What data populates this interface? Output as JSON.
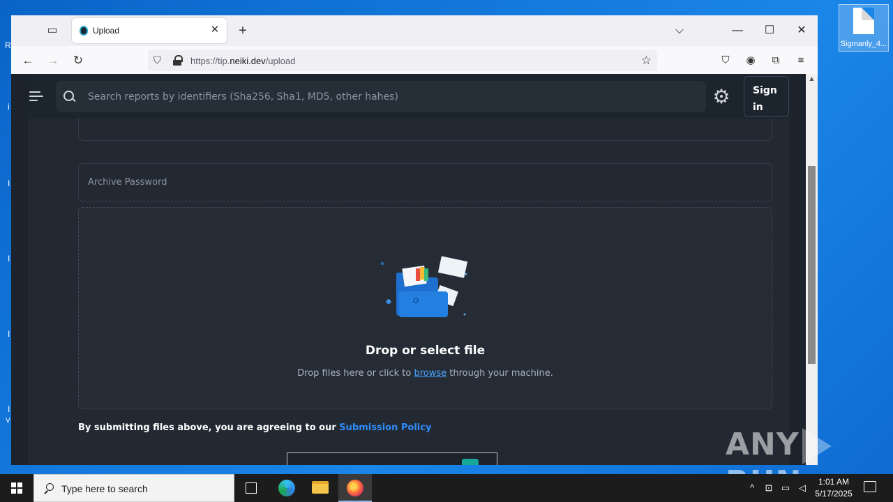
{
  "desktop": {
    "file_label": "Sigmanly_4...",
    "left_letters": [
      "R",
      "i",
      "I",
      "I",
      "I",
      "I",
      "V"
    ]
  },
  "browser": {
    "tab": {
      "title": "Upload"
    },
    "url": {
      "prefix": "https://tip.",
      "domain": "neiki.dev",
      "path": "/upload"
    }
  },
  "app": {
    "search": {
      "placeholder": "Search reports by identifiers (Sha256, Sha1, MD5, other hahes)"
    },
    "signin_label": "Sign in",
    "archive_password_placeholder": "Archive Password",
    "dropzone": {
      "title": "Drop or select file",
      "sub_before": "Drop files here or click to ",
      "sub_link": "browse",
      "sub_after": " through your machine."
    },
    "agreement": {
      "text": "By submitting files above, you are agreeing to our ",
      "link": "Submission Policy"
    }
  },
  "watermark": {
    "left": "ANY",
    "right": "RUN"
  },
  "taskbar": {
    "search_placeholder": "Type here to search",
    "time": "1:01 AM",
    "date": "5/17/2025"
  }
}
